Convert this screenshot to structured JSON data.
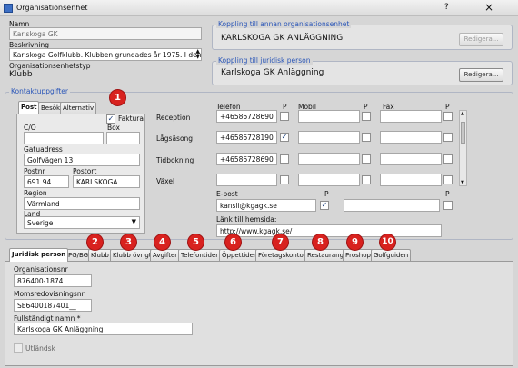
{
  "window": {
    "title": "Organisationsenhet",
    "help": "?",
    "close": "×"
  },
  "main": {
    "name_label": "Namn",
    "name_value": "Karlskoga GK",
    "desc_label": "Beskrivning",
    "desc_value": "Karlskoga Golfklubb. Klubben grundades år 1975. I den",
    "type_label": "Organisationsenhetstyp",
    "type_value": "Klubb"
  },
  "coupling_org": {
    "title": "Koppling till annan organisationsenhet",
    "value": "KARLSKOGA GK ANLÄGGNING",
    "button": "Redigera..."
  },
  "coupling_legal": {
    "title": "Koppling till juridisk person",
    "value": "Karlskoga GK Anläggning",
    "button": "Redigera..."
  },
  "contact": {
    "title": "Kontaktuppgifter",
    "tabs": [
      "Post",
      "Besök",
      "Alternativ"
    ],
    "co_label": "C/O",
    "faktura_label": "Faktura Box",
    "faktura_checked": "✓",
    "street_label": "Gatuadress",
    "street_value": "Golfvägen 13",
    "zip_label": "Postnr",
    "zip_value": "691 94",
    "city_label": "Postort",
    "city_value": "KARLSKOGA",
    "region_label": "Region",
    "region_value": "Värmland",
    "country_label": "Land",
    "country_value": "Sverige",
    "col_phone": "Telefon",
    "col_p": "P",
    "col_mobile": "Mobil",
    "col_fax": "Fax",
    "rows": [
      {
        "label": "Reception",
        "phone": "+46586728690",
        "p": ""
      },
      {
        "label": "Lågsäsong",
        "phone": "+46586728190",
        "p": "✓"
      },
      {
        "label": "Tidbokning",
        "phone": "+46586728690",
        "p": ""
      },
      {
        "label": "Växel",
        "phone": "",
        "p": ""
      }
    ],
    "email_label": "E-post",
    "email_value": "kansli@kgagk.se",
    "email_p": "✓",
    "web_label": "Länk till hemsida:",
    "web_value": "http://www.kgagk.se/"
  },
  "bottom_tabs": [
    "Juridisk person",
    "PG/BG",
    "Klubb",
    "Klubb övrigt",
    "Avgifter",
    "Telefontider",
    "Öppettider",
    "Företagskontor",
    "Restaurang",
    "Proshop",
    "Golfguiden"
  ],
  "badges": [
    "1",
    "2",
    "3",
    "4",
    "5",
    "6",
    "7",
    "8",
    "9",
    "10"
  ],
  "legal": {
    "orgnr_label": "Organisationsnr",
    "orgnr_value": "876400-1874",
    "vat_label": "Momsredovisningsnr",
    "vat_value": "SE6400187401__",
    "fullname_label": "Fullständigt namn *",
    "fullname_value": "Karlskoga GK Anläggning",
    "foreign_label": "Utländsk"
  }
}
